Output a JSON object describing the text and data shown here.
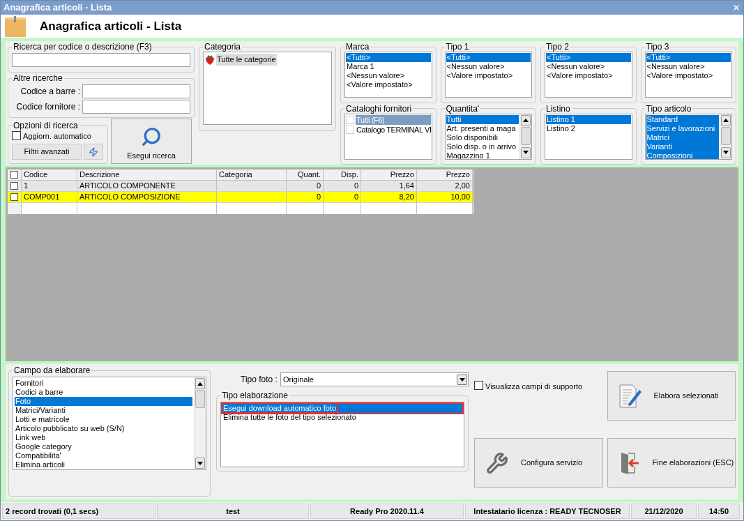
{
  "window": {
    "title": "Anagrafica articoli  - Lista"
  },
  "header": {
    "title": "Anagrafica articoli  - Lista"
  },
  "search": {
    "label": "Ricerca per codice o descrizione (F3)"
  },
  "other_searches": {
    "label": "Altre ricerche",
    "fields": [
      {
        "label": "Codice a barre :"
      },
      {
        "label": "Codice fornitore :"
      }
    ]
  },
  "search_options": {
    "label": "Opzioni di ricerca",
    "auto_update": {
      "label": "Aggiorn. automatico",
      "checked": false
    },
    "advanced_button": "Filtri avanzati"
  },
  "search_button": "Esegui ricerca",
  "category": {
    "label": "Categoria",
    "items": [
      {
        "label": "Tutte le categorie",
        "selected": true
      }
    ]
  },
  "filters": [
    {
      "label": "Marca",
      "kind": "list",
      "scrollable": false,
      "items": [
        {
          "label": "<Tutti>",
          "selected": true
        },
        {
          "label": "Marca 1",
          "selected": false
        },
        {
          "label": "<Nessun valore>",
          "selected": false
        },
        {
          "label": "<Valore impostato>",
          "selected": false
        }
      ]
    },
    {
      "label": "Tipo 1",
      "kind": "list",
      "scrollable": false,
      "items": [
        {
          "label": "<Tutti>",
          "selected": true
        },
        {
          "label": "<Nessun valore>",
          "selected": false
        },
        {
          "label": "<Valore impostato>",
          "selected": false
        }
      ]
    },
    {
      "label": "Tipo 2",
      "kind": "list",
      "scrollable": false,
      "items": [
        {
          "label": "<Tutti>",
          "selected": true
        },
        {
          "label": "<Nessun valore>",
          "selected": false
        },
        {
          "label": "<Valore impostato>",
          "selected": false
        }
      ]
    },
    {
      "label": "Tipo 3",
      "kind": "list",
      "scrollable": false,
      "items": [
        {
          "label": "<Tutti>",
          "selected": true
        },
        {
          "label": "<Nessun valore>",
          "selected": false
        },
        {
          "label": "<Valore impostato>",
          "selected": false
        }
      ]
    },
    {
      "label": "Cataloghi fornitori",
      "kind": "checklist",
      "scrollable": false,
      "items": [
        {
          "label": "Tutti (F6)",
          "selected": true,
          "checked": false
        },
        {
          "label": "Catalogo TERMINAL VI",
          "selected": false,
          "checked": false
        }
      ]
    },
    {
      "label": "Quantita'",
      "kind": "list",
      "scrollable": true,
      "items": [
        {
          "label": "Tutti",
          "selected": true
        },
        {
          "label": "Art. presenti a maga",
          "selected": false
        },
        {
          "label": "Solo disponibili",
          "selected": false
        },
        {
          "label": "Solo disp. o in arrivo",
          "selected": false
        },
        {
          "label": "Magazzino 1",
          "selected": false
        }
      ]
    },
    {
      "label": "Listino",
      "kind": "list",
      "scrollable": false,
      "items": [
        {
          "label": "Listino 1",
          "selected": true
        },
        {
          "label": "Listino 2",
          "selected": false
        }
      ]
    },
    {
      "label": "Tipo articolo",
      "kind": "list",
      "scrollable": true,
      "items": [
        {
          "label": "Standard",
          "selected": true
        },
        {
          "label": "Servizi e lavorazioni",
          "selected": true
        },
        {
          "label": "Matrici",
          "selected": true
        },
        {
          "label": "Varianti",
          "selected": true
        },
        {
          "label": "Composizioni",
          "selected": true
        }
      ]
    }
  ],
  "table": {
    "select_all_checked": false,
    "columns": [
      {
        "label": "Codice",
        "kind": "text"
      },
      {
        "label": "Descrizione",
        "kind": "text"
      },
      {
        "label": "Categoria",
        "kind": "text"
      },
      {
        "label": "Quant.",
        "kind": "number"
      },
      {
        "label": "Disp.",
        "kind": "number"
      },
      {
        "label": "Prezzo",
        "kind": "number"
      },
      {
        "label": "Prezzo",
        "kind": "number"
      }
    ],
    "rows": [
      {
        "checked": false,
        "highlighted": false,
        "cells": [
          "1",
          "ARTICOLO COMPONENTE",
          "",
          "0",
          "0",
          "1,64",
          "2,00"
        ]
      },
      {
        "checked": false,
        "highlighted": true,
        "cells": [
          "COMP001",
          "ARTICOLO COMPOSIZIONE",
          "",
          "0",
          "0",
          "8,20",
          "10,00"
        ]
      }
    ]
  },
  "fields_to_process": {
    "label": "Campo da elaborare",
    "items": [
      {
        "label": "Fornitori",
        "selected": false
      },
      {
        "label": "Codici a barre",
        "selected": false
      },
      {
        "label": "Foto",
        "selected": true
      },
      {
        "label": "Matrici/Varianti",
        "selected": false
      },
      {
        "label": "Lotti e matricole",
        "selected": false
      },
      {
        "label": "Articolo pubblicato su web (S/N)",
        "selected": false
      },
      {
        "label": "Link web",
        "selected": false
      },
      {
        "label": "Google category",
        "selected": false
      },
      {
        "label": "Compatibilita'",
        "selected": false
      },
      {
        "label": "Elimina articoli",
        "selected": false
      }
    ]
  },
  "photo_type": {
    "label": "Tipo foto :",
    "value": "Originale"
  },
  "processing_type": {
    "label": "Tipo elaborazione",
    "items": [
      {
        "label": "Esegui download automatico foto",
        "selected": true,
        "outlined": true
      },
      {
        "label": "Elimina tutte le foto del tipo selezionato",
        "selected": false,
        "outlined": false
      }
    ]
  },
  "support_fields": {
    "label": "Visualizza campi di supporto",
    "checked": false
  },
  "actions": [
    {
      "label": "Elabora selezionati",
      "kind": "edit"
    },
    {
      "label": "Configura servizio",
      "kind": "settings"
    },
    {
      "label": "Fine elaborazioni (ESC)",
      "kind": "exit"
    }
  ],
  "status_bar": [
    "2 record trovati (0,1 secs)",
    "test",
    "Ready Pro 2020.11.4",
    "Intestatario licenza : READY TECNOSER",
    "21/12/2020",
    "14:50"
  ]
}
